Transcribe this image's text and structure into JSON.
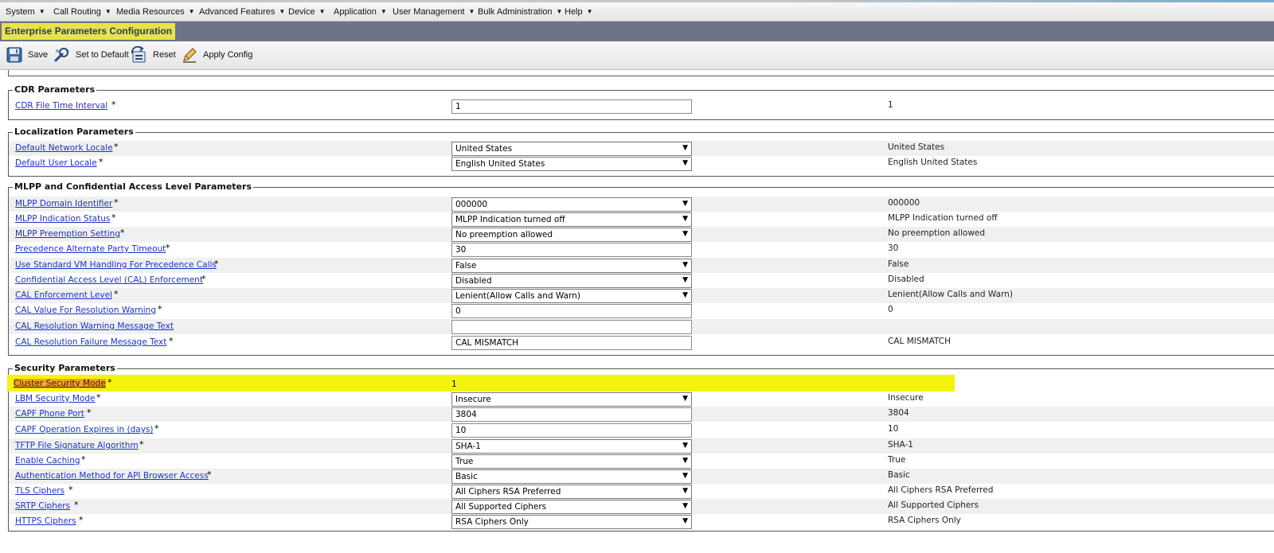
{
  "menu": [
    {
      "label": "System"
    },
    {
      "label": "Call Routing"
    },
    {
      "label": "Media Resources"
    },
    {
      "label": "Advanced Features"
    },
    {
      "label": "Device"
    },
    {
      "label": "Application"
    },
    {
      "label": "User Management"
    },
    {
      "label": "Bulk Administration"
    },
    {
      "label": "Help"
    }
  ],
  "page_title": "Enterprise Parameters Configuration",
  "toolbar": {
    "save": "Save",
    "set_default": "Set to Default",
    "reset": "Reset",
    "apply_config": "Apply Config"
  },
  "sections": {
    "cdr": {
      "legend": "CDR Parameters",
      "rows": [
        {
          "label": "CDR File Time Interval",
          "value": "1",
          "default": "1"
        }
      ]
    },
    "localization": {
      "legend": "Localization Parameters",
      "rows": [
        {
          "label": "Default Network Locale",
          "value": "United States",
          "default": "United States"
        },
        {
          "label": "Default User Locale",
          "value": "English United States",
          "default": "English United States"
        }
      ]
    },
    "mlpp": {
      "legend": "MLPP and Confidential Access Level Parameters",
      "rows": [
        {
          "label": "MLPP Domain Identifier",
          "value": "000000",
          "default": "000000"
        },
        {
          "label": "MLPP Indication Status",
          "value": "MLPP Indication turned off",
          "default": "MLPP Indication turned off"
        },
        {
          "label": "MLPP Preemption Setting",
          "value": "No preemption allowed",
          "default": "No preemption allowed"
        },
        {
          "label": "Precedence Alternate Party Timeout",
          "value": "30",
          "default": "30"
        },
        {
          "label": "Use Standard VM Handling For Precedence Calls",
          "value": "False",
          "default": "False"
        },
        {
          "label": "Confidential Access Level (CAL) Enforcement",
          "value": "Disabled",
          "default": "Disabled"
        },
        {
          "label": "CAL Enforcement Level",
          "value": "Lenient(Allow Calls and Warn)",
          "default": "Lenient(Allow Calls and Warn)"
        },
        {
          "label": "CAL Value For Resolution Warning",
          "value": "0",
          "default": "0"
        },
        {
          "label": "CAL Resolution Warning Message Text",
          "value": "",
          "default": ""
        },
        {
          "label": "CAL Resolution Failure Message Text",
          "value": "CAL MISMATCH",
          "default": "CAL MISMATCH"
        }
      ]
    },
    "security": {
      "legend": "Security Parameters",
      "rows": [
        {
          "label": "Cluster Security Mode",
          "value": "1",
          "default": ""
        },
        {
          "label": "LBM Security Mode",
          "value": "Insecure",
          "default": "Insecure"
        },
        {
          "label": "CAPF Phone Port",
          "value": "3804",
          "default": "3804"
        },
        {
          "label": "CAPF Operation Expires in (days)",
          "value": "10",
          "default": "10"
        },
        {
          "label": "TFTP File Signature Algorithm",
          "value": "SHA-1",
          "default": "SHA-1"
        },
        {
          "label": "Enable Caching",
          "value": "True",
          "default": "True"
        },
        {
          "label": "Authentication Method for API Browser Access",
          "value": "Basic",
          "default": "Basic"
        },
        {
          "label": "TLS Ciphers",
          "value": "All Ciphers RSA Preferred",
          "default": "All Ciphers RSA Preferred"
        },
        {
          "label": "SRTP Ciphers",
          "value": "All Supported Ciphers",
          "default": "All Supported Ciphers"
        },
        {
          "label": "HTTPS Ciphers",
          "value": "RSA Ciphers Only",
          "default": "RSA Ciphers Only"
        }
      ]
    }
  },
  "required_marker": "*",
  "dropdown_arrow": "▼",
  "colors": {
    "title_bg": "#6d7487",
    "title_highlight": "#e7e34a",
    "link": "#1c33c8",
    "row_highlight": "#f4f40a",
    "label_highlight": "#f2a227"
  }
}
